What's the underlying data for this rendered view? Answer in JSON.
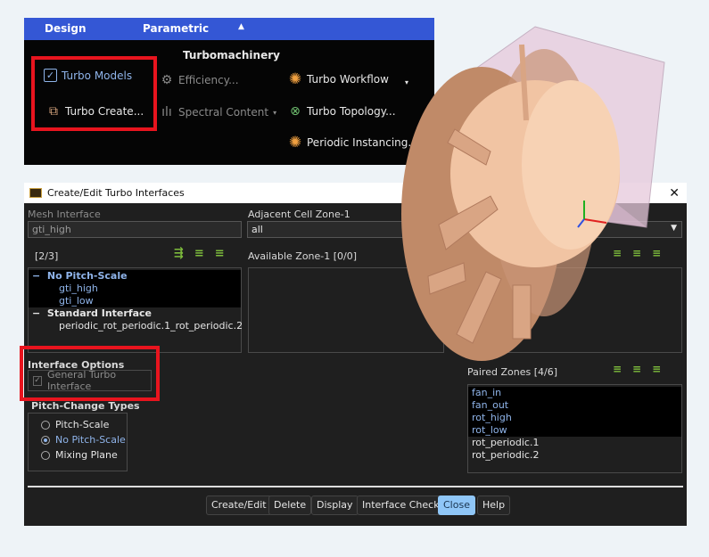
{
  "ribbon": {
    "tabs": [
      "Design",
      "Parametric"
    ],
    "group_title": "Turbomachinery",
    "items": [
      {
        "label": "Turbo Models",
        "icon": "checkbox-icon"
      },
      {
        "label": "Turbo Create...",
        "icon": "turbo-create-icon"
      },
      {
        "label": "Efficiency...",
        "icon": "efficiency-icon"
      },
      {
        "label": "Spectral Content",
        "icon": "spectrum-icon"
      },
      {
        "label": "Turbo Workflow",
        "icon": "fan-icon"
      },
      {
        "label": "Turbo Topology...",
        "icon": "topology-icon"
      },
      {
        "label": "Periodic Instancing...",
        "icon": "fan-icon"
      }
    ]
  },
  "dialog": {
    "title": "Create/Edit Turbo Interfaces",
    "mesh_interface_label": "Mesh Interface",
    "mesh_interface_value": "gti_high",
    "adjacent_label": "Adjacent Cell Zone-1",
    "adjacent_value": "all",
    "interfaces_count": "[2/3]",
    "tree": [
      {
        "group": "No Pitch-Scale",
        "items": [
          "gti_high",
          "gti_low"
        ]
      },
      {
        "group": "Standard Interface",
        "items": [
          "periodic_rot_periodic.1_rot_periodic.2"
        ]
      }
    ],
    "available_label": "Available Zone-1  [0/0]",
    "interface_options_label": "Interface Options",
    "general_turbo_label": "General Turbo Interface",
    "pitch_label": "Pitch-Change Types",
    "pitch_options": [
      "Pitch-Scale",
      "No Pitch-Scale",
      "Mixing Plane"
    ],
    "pitch_selected": "No Pitch-Scale",
    "paired_label": "Paired Zones [4/6]",
    "paired_zones": [
      "fan_in",
      "fan_out",
      "rot_high",
      "rot_low",
      "rot_periodic.1",
      "rot_periodic.2"
    ],
    "buttons": [
      "Create/Edit",
      "Delete",
      "Display",
      "Interface Check",
      "Close",
      "Help"
    ]
  },
  "colors": {
    "accent": "#3457d5",
    "highlight": "#e8141e",
    "selected_text": "#8fb4ea",
    "primary_button": "#8fc6f7"
  }
}
